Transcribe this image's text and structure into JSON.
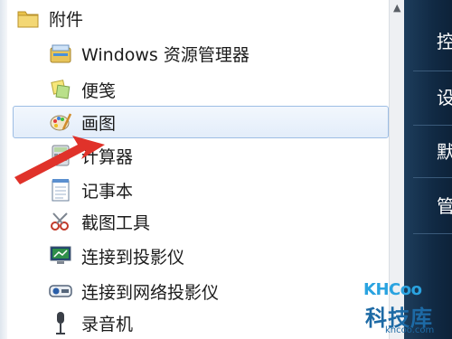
{
  "folder": {
    "label": "附件",
    "icon": "folder-icon"
  },
  "items": [
    {
      "label": "Windows 资源管理器",
      "icon": "explorer-icon"
    },
    {
      "label": "便笺",
      "icon": "sticky-notes-icon"
    },
    {
      "label": "画图",
      "icon": "paint-icon",
      "selected": true
    },
    {
      "label": "计算器",
      "icon": "calculator-icon"
    },
    {
      "label": "记事本",
      "icon": "notepad-icon"
    },
    {
      "label": "截图工具",
      "icon": "snipping-tool-icon"
    },
    {
      "label": "连接到投影仪",
      "icon": "projector-icon"
    },
    {
      "label": "连接到网络投影仪",
      "icon": "network-projector-icon"
    },
    {
      "label": "录音机",
      "icon": "microphone-icon"
    }
  ],
  "right_panel": {
    "items": [
      "控",
      "设",
      "默",
      "管"
    ]
  },
  "watermark": {
    "logo": "KHCoo",
    "name": "科技库",
    "url": "khcoo.com"
  },
  "colors": {
    "selection_border": "#9dbde4",
    "arrow": "#e0322a",
    "right_panel": "#112a44"
  }
}
